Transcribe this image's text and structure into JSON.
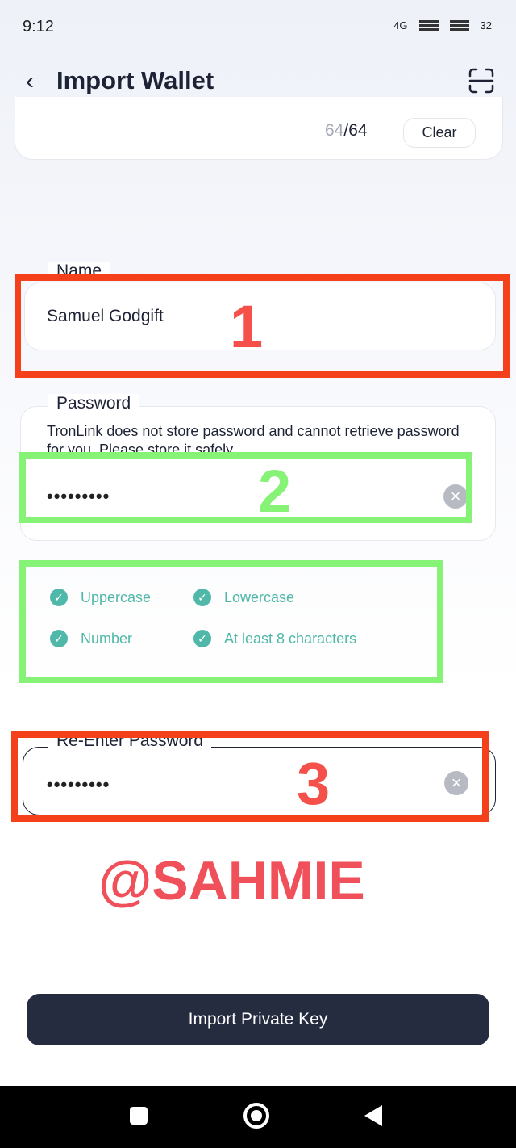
{
  "status_bar": {
    "time": "9:12",
    "network": "4G",
    "battery": "32"
  },
  "header": {
    "title": "Import Wallet",
    "back_icon": "chevron-left-icon",
    "scan_icon": "scan-icon"
  },
  "private_key": {
    "count_used": "64",
    "count_total": "/64",
    "clear_label": "Clear"
  },
  "name": {
    "label": "Name",
    "value": "Samuel Godgift"
  },
  "password": {
    "label": "Password",
    "info": "TronLink does not store password and cannot retrieve password for you. Please store it safely.",
    "value": "•••••••••"
  },
  "requirements": [
    {
      "label": "Uppercase",
      "met": true
    },
    {
      "label": "Lowercase",
      "met": true
    },
    {
      "label": "Number",
      "met": true
    },
    {
      "label": "At least 8 characters",
      "met": true
    }
  ],
  "reenter": {
    "label": "Re-Enter Password",
    "value": "•••••••••"
  },
  "submit_label": "Import Private Key",
  "annotations": {
    "n1": "1",
    "n2": "2",
    "n3": "3",
    "watermark": "@SAHMIE",
    "red": "#f5401c",
    "green": "#86f276"
  },
  "colors": {
    "accent": "#4fb8a9",
    "button": "#252c40"
  }
}
